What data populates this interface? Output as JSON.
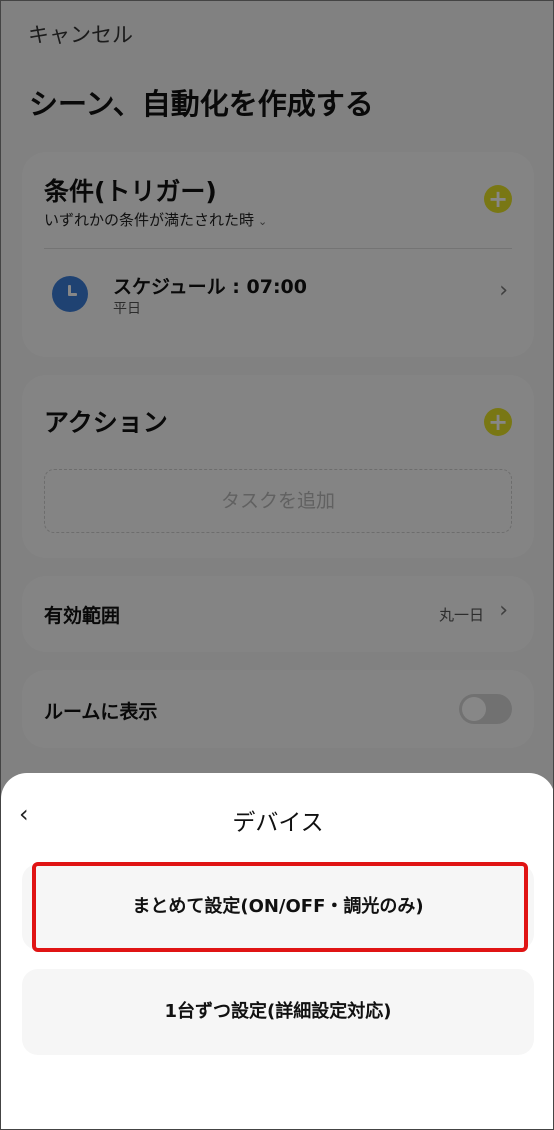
{
  "header": {
    "cancel_label": "キャンセル",
    "title": "シーン、自動化を作成する"
  },
  "trigger_card": {
    "title": "条件(トリガー)",
    "condition_mode": "いずれかの条件が満たされた時",
    "schedule": {
      "title": "スケジュール : 07:00",
      "subtitle": "平日"
    }
  },
  "action_card": {
    "title": "アクション",
    "add_task_label": "タスクを追加"
  },
  "scope_row": {
    "label": "有効範囲",
    "value": "丸一日"
  },
  "room_row": {
    "label": "ルームに表示",
    "toggle_on": false
  },
  "sheet": {
    "title": "デバイス",
    "options": [
      {
        "label": "まとめて設定(ON/OFF・調光のみ)"
      },
      {
        "label": "1台ずつ設定(詳細設定対応)"
      }
    ]
  },
  "colors": {
    "accent_yellow": "#e4e027",
    "clock_blue": "#3b7dd8",
    "highlight_red": "#e01414"
  }
}
